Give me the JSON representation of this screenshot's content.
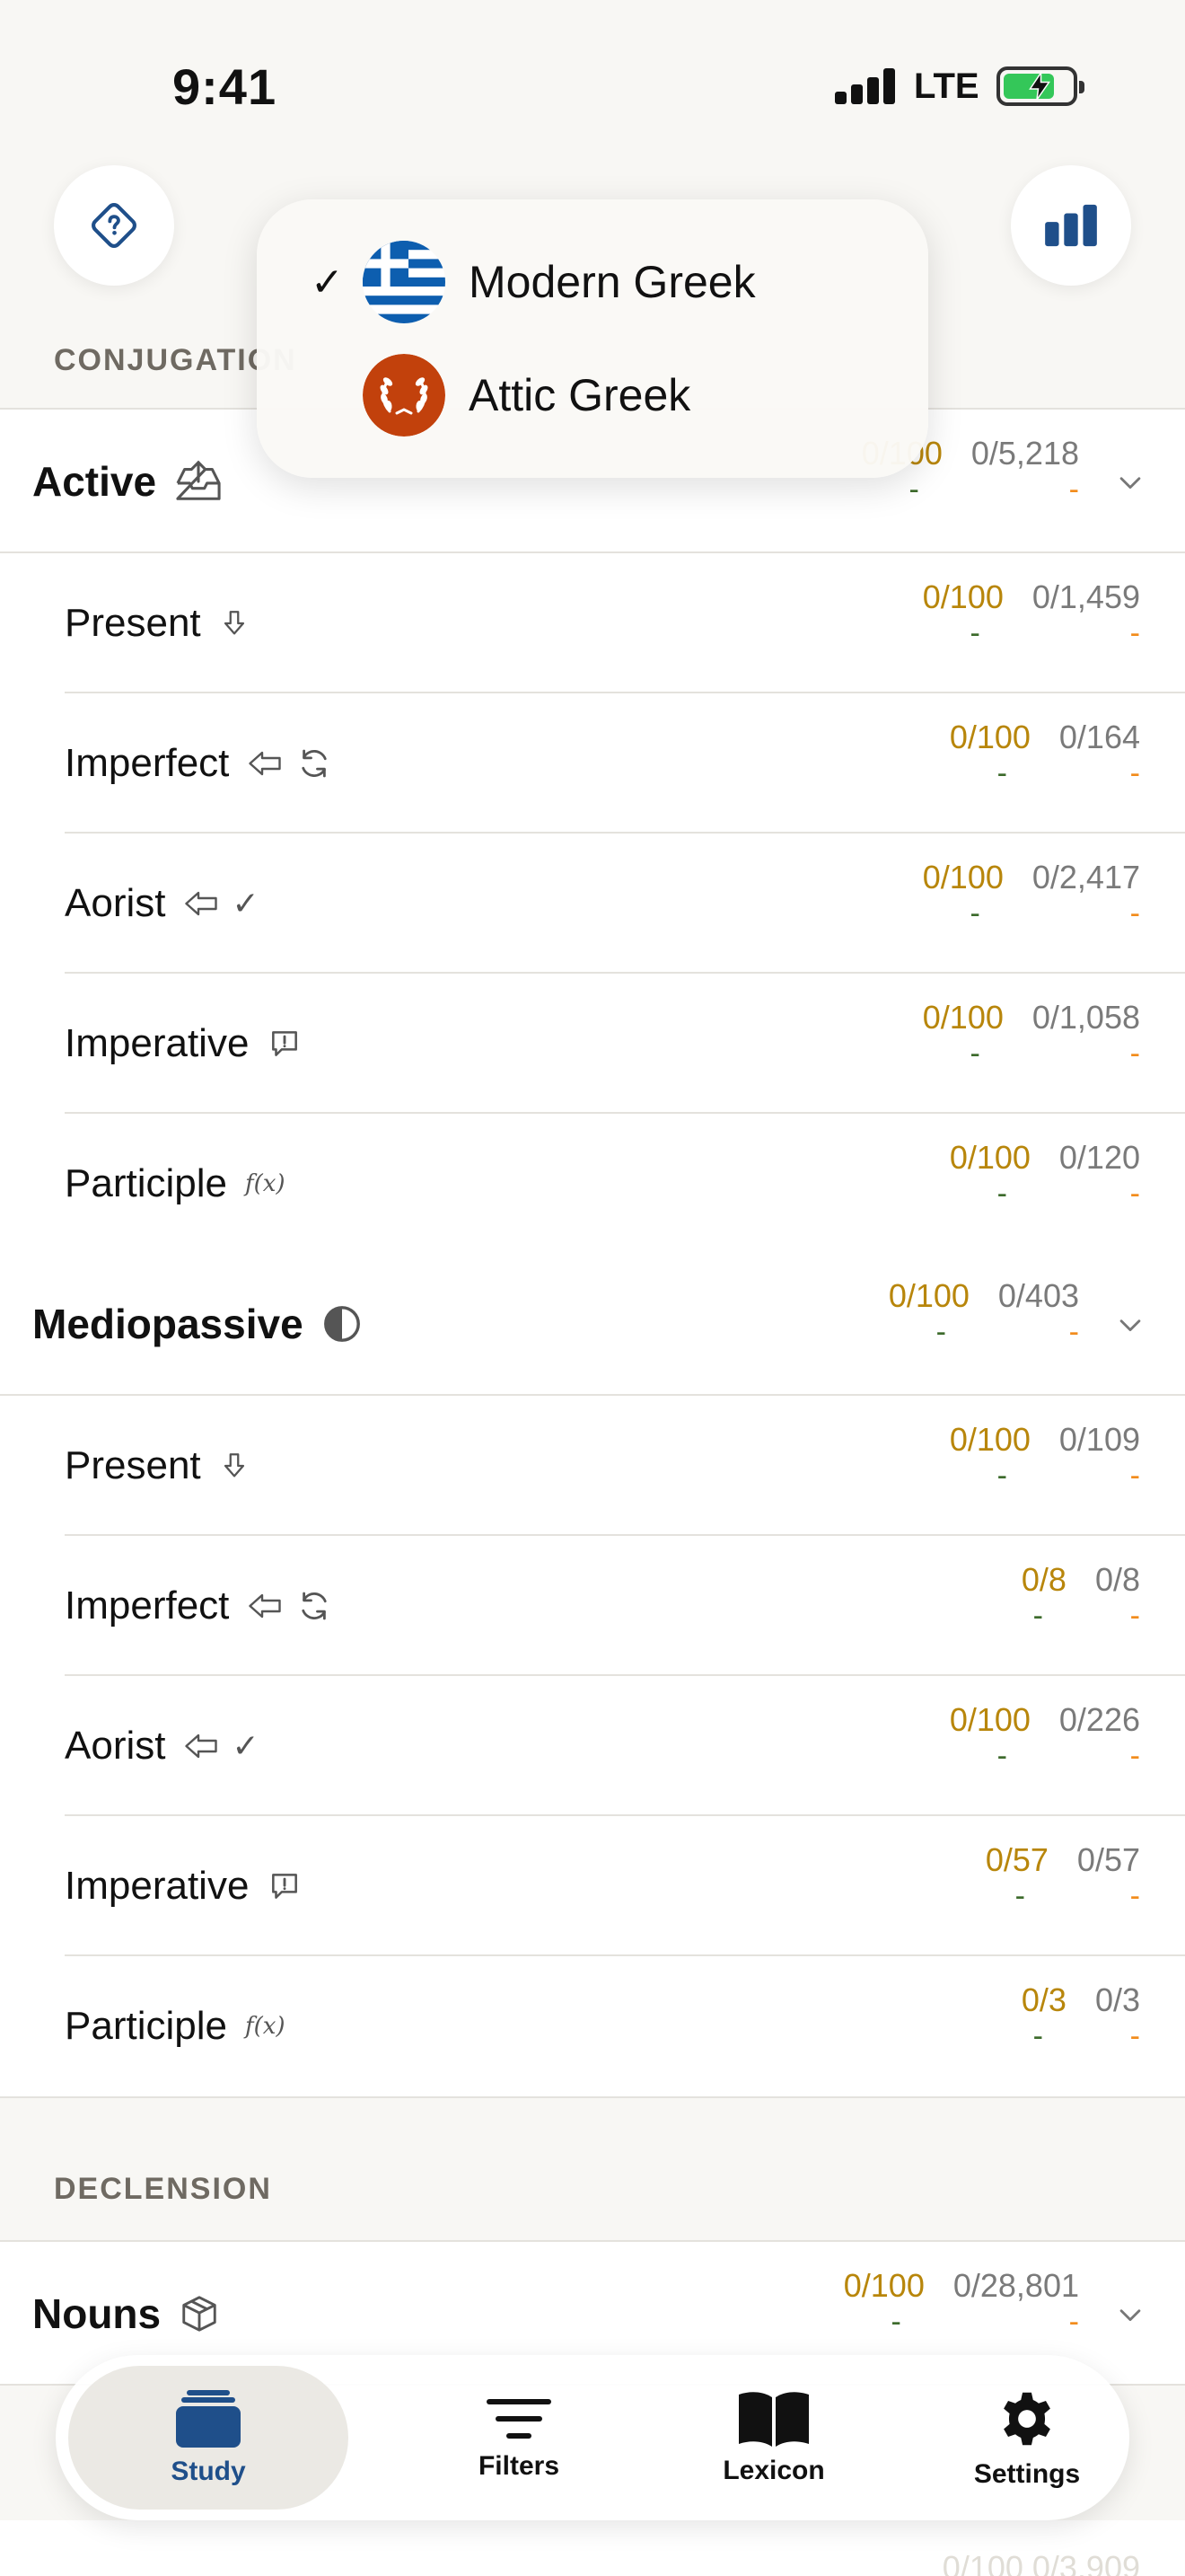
{
  "status_bar": {
    "time": "9:41",
    "network": "LTE"
  },
  "top": {
    "help_icon": "question-diamond-icon",
    "stats_icon": "bar-chart-icon"
  },
  "dropdown": {
    "items": [
      {
        "label": "Modern Greek",
        "selected": true,
        "icon": "greek-flag-icon"
      },
      {
        "label": "Attic Greek",
        "selected": false,
        "icon": "laurel-wreath-icon"
      }
    ]
  },
  "sections": {
    "conjugation": "CONJUGATION",
    "declension": "DECLENSION"
  },
  "active": {
    "label": "Active",
    "icon": "tray-upload-icon",
    "stat_a": "0/100",
    "stat_b": "0/5,218",
    "dash_a": "-",
    "dash_b": "-",
    "rows": [
      {
        "label": "Present",
        "stat_a": "0/100",
        "stat_b": "0/1,459",
        "dash_a": "-",
        "dash_b": "-"
      },
      {
        "label": "Imperfect",
        "stat_a": "0/100",
        "stat_b": "0/164",
        "dash_a": "-",
        "dash_b": "-"
      },
      {
        "label": "Aorist",
        "stat_a": "0/100",
        "stat_b": "0/2,417",
        "dash_a": "-",
        "dash_b": "-"
      },
      {
        "label": "Imperative",
        "stat_a": "0/100",
        "stat_b": "0/1,058",
        "dash_a": "-",
        "dash_b": "-"
      },
      {
        "label": "Participle",
        "stat_a": "0/100",
        "stat_b": "0/120",
        "dash_a": "-",
        "dash_b": "-"
      }
    ]
  },
  "mediopassive": {
    "label": "Mediopassive",
    "icon": "half-circle-icon",
    "stat_a": "0/100",
    "stat_b": "0/403",
    "dash_a": "-",
    "dash_b": "-",
    "rows": [
      {
        "label": "Present",
        "stat_a": "0/100",
        "stat_b": "0/109",
        "dash_a": "-",
        "dash_b": "-"
      },
      {
        "label": "Imperfect",
        "stat_a": "0/8",
        "stat_b": "0/8",
        "dash_a": "-",
        "dash_b": "-"
      },
      {
        "label": "Aorist",
        "stat_a": "0/100",
        "stat_b": "0/226",
        "dash_a": "-",
        "dash_b": "-"
      },
      {
        "label": "Imperative",
        "stat_a": "0/57",
        "stat_b": "0/57",
        "dash_a": "-",
        "dash_b": "-"
      },
      {
        "label": "Participle",
        "stat_a": "0/3",
        "stat_b": "0/3",
        "dash_a": "-",
        "dash_b": "-"
      }
    ]
  },
  "nouns": {
    "label": "Nouns",
    "icon": "cube-icon",
    "stat_a": "0/100",
    "stat_b": "0/28,801",
    "dash_a": "-",
    "dash_b": "-"
  },
  "faded_bottom": "0/100   0/3,909",
  "tabbar": {
    "study": "Study",
    "filters": "Filters",
    "lexicon": "Lexicon",
    "settings": "Settings"
  },
  "colors": {
    "accent": "#1f4f8a",
    "stat_done": "#b8860b",
    "stat_dash_green": "#3d6b2c",
    "stat_dash_orange": "#f28c1c",
    "stat_total": "#7a7a7a"
  }
}
